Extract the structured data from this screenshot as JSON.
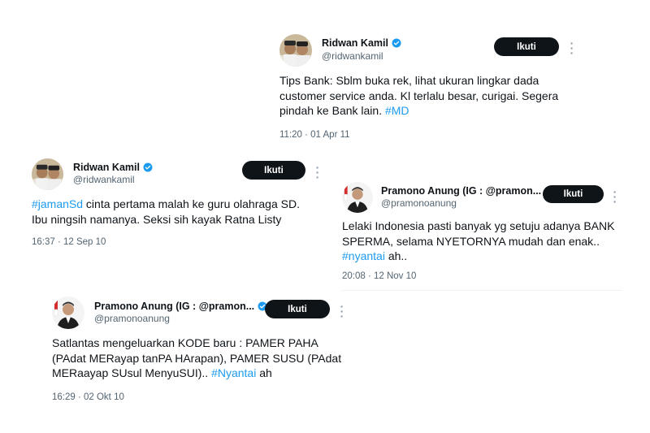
{
  "tweets": [
    {
      "name": "Ridwan Kamil",
      "handle": "@ridwankamil",
      "follow_label": "Ikuti",
      "text_lines": [
        [
          "Tips Bank: Sblm buka rek, lihat ukuran lingkar dada"
        ],
        [
          "customer service anda. Kl terlalu besar, curigai. Segera"
        ],
        [
          "pindah ke Bank lain. ",
          "#MD"
        ]
      ],
      "timestamp": "11:20 · 01 Apr 11"
    },
    {
      "name": "Ridwan Kamil",
      "handle": "@ridwankamil",
      "follow_label": "Ikuti",
      "text_lines": [
        [
          "#jamanSd",
          " cinta pertama malah ke guru olahraga SD."
        ],
        [
          "Ibu ningsih namanya. Seksi sih kayak Ratna Listy"
        ]
      ],
      "timestamp": "16:37 · 12 Sep 10"
    },
    {
      "name": "Pramono Anung (IG : @pramon...",
      "handle": "@pramonoanung",
      "follow_label": "Ikuti",
      "text_lines": [
        [
          "Lelaki Indonesia pasti banyak yg setuju adanya BANK"
        ],
        [
          "SPERMA,  selama NYETORNYA mudah dan enak.."
        ],
        [
          "#nyantai",
          " ah.."
        ]
      ],
      "timestamp": "20:08 · 12 Nov 10"
    },
    {
      "name": "Pramono Anung (IG : @pramon...",
      "handle": "@pramonoanung",
      "follow_label": "Ikuti",
      "text_lines": [
        [
          "Satlantas mengeluarkan KODE  baru : PAMER PAHA"
        ],
        [
          "(PAdat MERayap tanPA HArapan), PAMER SUSU (PAdat"
        ],
        [
          "MERaayap SUsul MenyuSUI).. ",
          "#Nyantai",
          " ah"
        ]
      ],
      "timestamp": "16:29 · 02 Okt 10"
    }
  ],
  "colors": {
    "hashtag": "#1d9bf0",
    "verified": "#1d9bf0",
    "button": "#0f1419",
    "muted": "#536471"
  },
  "icons": {
    "verified": "verified-badge-icon",
    "more": "more-options-icon"
  }
}
